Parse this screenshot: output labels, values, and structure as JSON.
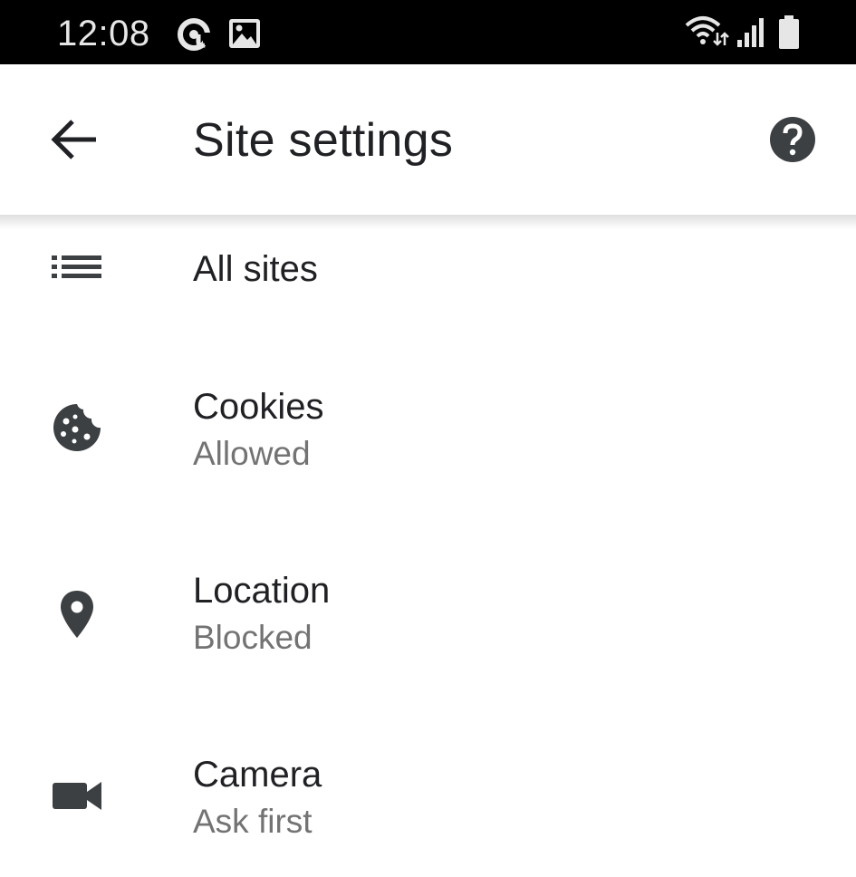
{
  "status_bar": {
    "time": "12:08",
    "notification_icons": [
      "at-sign-icon",
      "image-icon"
    ],
    "system_icons": [
      "wifi-icon",
      "signal-icon",
      "battery-icon"
    ]
  },
  "app_bar": {
    "back_icon": "arrow-back-icon",
    "title": "Site settings",
    "help_icon": "help-icon"
  },
  "items": [
    {
      "icon": "list-icon",
      "title": "All sites",
      "subtitle": ""
    },
    {
      "icon": "cookie-icon",
      "title": "Cookies",
      "subtitle": "Allowed"
    },
    {
      "icon": "location-pin-icon",
      "title": "Location",
      "subtitle": "Blocked"
    },
    {
      "icon": "videocam-icon",
      "title": "Camera",
      "subtitle": "Ask first"
    }
  ],
  "colors": {
    "status_bar_bg": "#000000",
    "text_primary": "#202124",
    "text_secondary": "#737373",
    "icon": "#3c4043"
  }
}
